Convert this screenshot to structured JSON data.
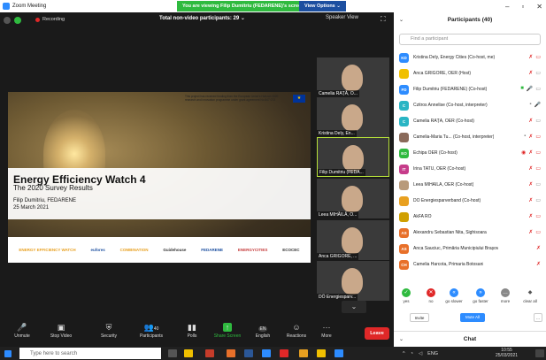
{
  "window": {
    "title": "Zoom Meeting"
  },
  "banner": {
    "viewing": "You are viewing Filip Dumitriu (FEDARENE)'s screen",
    "view_options": "View Options ⌄"
  },
  "meeting": {
    "recording": "Recording",
    "participants_count_text": "Total non-video participants: 29 ⌄",
    "speaker_view": "Speaker View"
  },
  "slide": {
    "funding_text": "This project has received funding from the European Union's Horizon 2020 research and innovation programme under grant agreement No 847 073",
    "title": "Energy Efficiency Watch 4",
    "subtitle": "The 2020 Survey Results",
    "presenter": "Filip Dumitriu, FEDARENE",
    "date": "25 March 2021",
    "logos": [
      "ENERGY EFFICIENCY WATCH",
      "eufores",
      "COMBINATION",
      "Guidehouse",
      "FEDARENE",
      "ENERGYCITIES",
      "ECOCEC"
    ]
  },
  "videos": [
    {
      "name": "Camelia RAȚĂ, O..."
    },
    {
      "name": "Kristina Dely, En..."
    },
    {
      "name": "Filip Dumitriu (FEDA..."
    },
    {
      "name": "Leea MIHĂILĂ, O..."
    },
    {
      "name": "Anca GRIGORE, ..."
    },
    {
      "name": "DÖ Energiesparv..."
    }
  ],
  "toolbar": {
    "unmute": "Unmute",
    "stop_video": "Stop Video",
    "security": "Security",
    "participants": "Participants",
    "participants_badge": "40",
    "polls": "Polls",
    "share_screen": "Share Screen",
    "english": "English",
    "english_badge": "EN",
    "reactions": "Reactions",
    "more": "More",
    "leave": "Leave"
  },
  "panel": {
    "header": "Participants (40)",
    "find_placeholder": "Find a participant",
    "participants": [
      {
        "initials": "KD",
        "name": "Kristina Dely, Energy Cities (Co-host, me)",
        "color": "#2d8cff"
      },
      {
        "initials": "",
        "name": "Anca GRIGORE, OER (Host)",
        "color": "#f0c000"
      },
      {
        "initials": "FD",
        "name": "Filip Dumitriu (FEDARENE) (Co-host)",
        "color": "#2d8cff"
      },
      {
        "initials": "C",
        "name": "Czitros Annelise (Co-host, interpreter)",
        "color": "#29b5c4"
      },
      {
        "initials": "C",
        "name": "Camelia RAȚĂ, OER (Co-host)",
        "color": "#29b5c4"
      },
      {
        "initials": "",
        "name": "Camelia-Maria Tu... (Co-host, interpreter)",
        "color": "#8a6a5a"
      },
      {
        "initials": "EO",
        "name": "Echipa OER (Co-host)",
        "color": "#2fba3f"
      },
      {
        "initials": "IT",
        "name": "Irina TATU, OER (Co-host)",
        "color": "#c63c8a"
      },
      {
        "initials": "",
        "name": "Leea MIHĂILĂ, OER (Co-host)",
        "color": "#b89a7a"
      },
      {
        "initials": "",
        "name": "DÖ Energiesparverband (Co-host)",
        "color": "#e8a020"
      },
      {
        "initials": "",
        "name": "AkFA RO",
        "color": "#d0a000"
      },
      {
        "initials": "AS",
        "name": "Alexandru Sebastian Nita, Sighisoara",
        "color": "#e8702a"
      },
      {
        "initials": "AS",
        "name": "Anca Sauciuc, Primăria Municipiului Brașov",
        "color": "#e8702a"
      },
      {
        "initials": "CH",
        "name": "Camelia Harcota, Primaria Botosani",
        "color": "#e8702a"
      }
    ],
    "reactions": [
      "yes",
      "no",
      "go slower",
      "go faster",
      "more",
      "clear all"
    ],
    "invite": "Invite",
    "mute_all": "Mute All",
    "more_btn": "...",
    "chat": "Chat"
  },
  "taskbar": {
    "search_placeholder": "Type here to search",
    "lang": "ENG",
    "time": "10:55",
    "date": "25/03/2021"
  }
}
